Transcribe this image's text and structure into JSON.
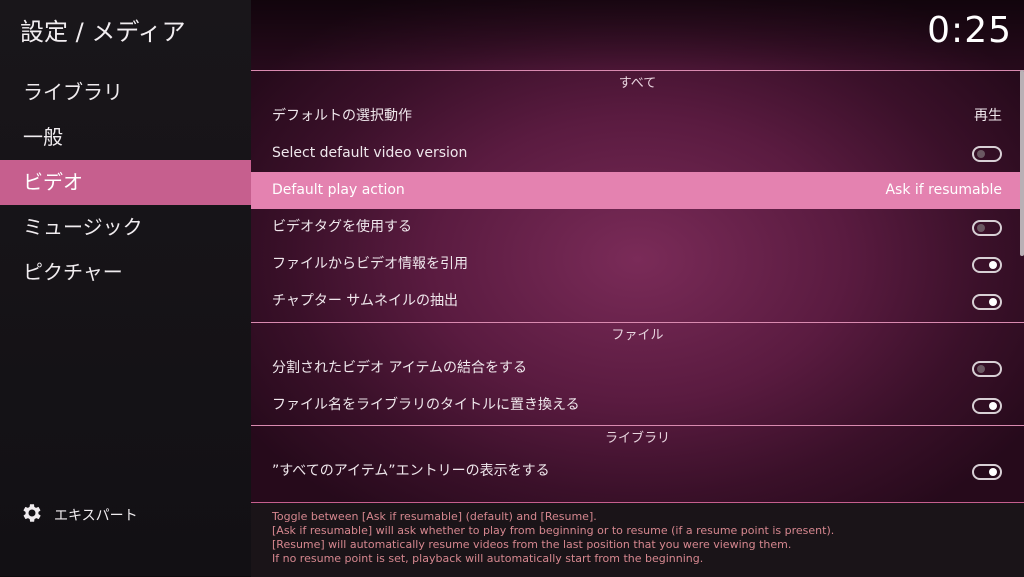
{
  "header": {
    "title": "設定 / メディア",
    "clock": "0:25"
  },
  "sidebar": {
    "items": [
      {
        "label": "ライブラリ"
      },
      {
        "label": "一般"
      },
      {
        "label": "ビデオ"
      },
      {
        "label": "ミュージック"
      },
      {
        "label": "ピクチャー"
      }
    ],
    "active_index": 2,
    "expert_label": "エキスパート",
    "expert_icon": "gear-icon"
  },
  "groups": {
    "all": "すべて",
    "files": "ファイル",
    "library": "ライブラリ"
  },
  "settings": [
    {
      "label": "デフォルトの選択動作",
      "value": "再生"
    },
    {
      "label": "Select default video version",
      "toggle": "off"
    },
    {
      "label": "Default play action",
      "value": "Ask if resumable",
      "focused": true
    },
    {
      "label": "ビデオタグを使用する",
      "toggle": "off"
    },
    {
      "label": "ファイルからビデオ情報を引用",
      "toggle": "on"
    },
    {
      "label": "チャプター サムネイルの抽出",
      "toggle": "on"
    },
    {
      "label": "分割されたビデオ アイテムの結合をする",
      "toggle": "off"
    },
    {
      "label": "ファイル名をライブラリのタイトルに置き換える",
      "toggle": "on"
    },
    {
      "label": "”すべてのアイテム”エントリーの表示をする",
      "toggle": "on"
    }
  ],
  "info": {
    "lines": [
      "Toggle between [Ask if resumable] (default) and [Resume].",
      "[Ask if resumable] will ask whether to play from beginning or to resume (if a resume point is present).",
      "[Resume] will automatically resume videos from the last position that you were viewing them.",
      "If no resume point is set, playback will automatically start from the beginning."
    ]
  },
  "colors": {
    "accent": "#c65f8e",
    "focus": "#e482b0",
    "info_text": "#d6878f"
  }
}
